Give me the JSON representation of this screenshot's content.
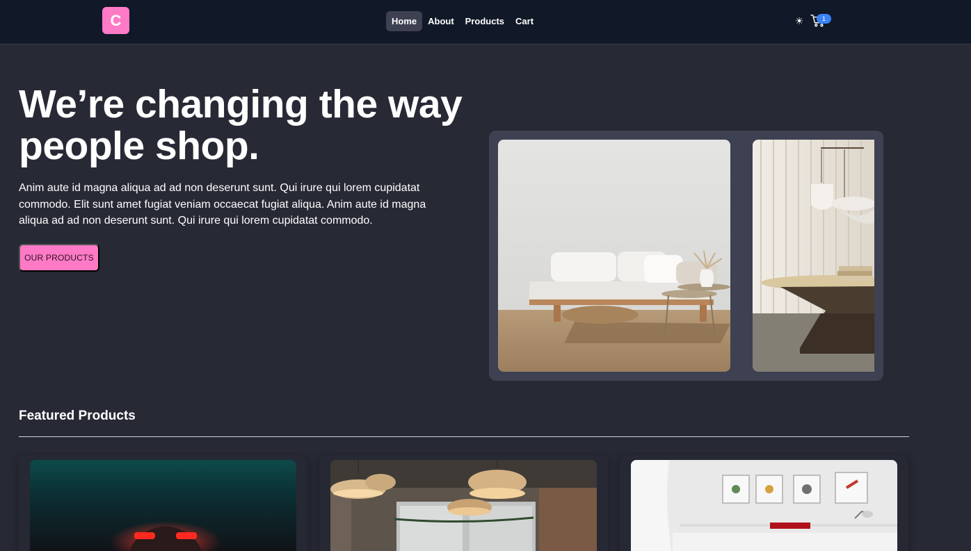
{
  "navbar": {
    "logo_letter": "C",
    "links": [
      {
        "label": "Home",
        "active": true
      },
      {
        "label": "About",
        "active": false
      },
      {
        "label": "Products",
        "active": false
      },
      {
        "label": "Cart",
        "active": false
      }
    ],
    "theme_icon": "sun-icon",
    "cart_icon": "cart-icon",
    "cart_count": "1"
  },
  "hero": {
    "title": "We’re changing the way people shop.",
    "text": "Anim aute id magna aliqua ad ad non deserunt sunt. Qui irure qui lorem cupidatat commodo. Elit sunt amet fugiat veniam occaecat fugiat aliqua. Anim aute id magna aliqua ad ad non deserunt sunt. Qui irure qui lorem cupidatat commodo.",
    "button_label": "OUR PRODUCTS"
  },
  "featured": {
    "title": "Featured Products"
  },
  "colors": {
    "accent": "#ff7ac6",
    "nav_bg": "#111827",
    "page_bg": "#272935",
    "badge": "#3b82f6"
  }
}
